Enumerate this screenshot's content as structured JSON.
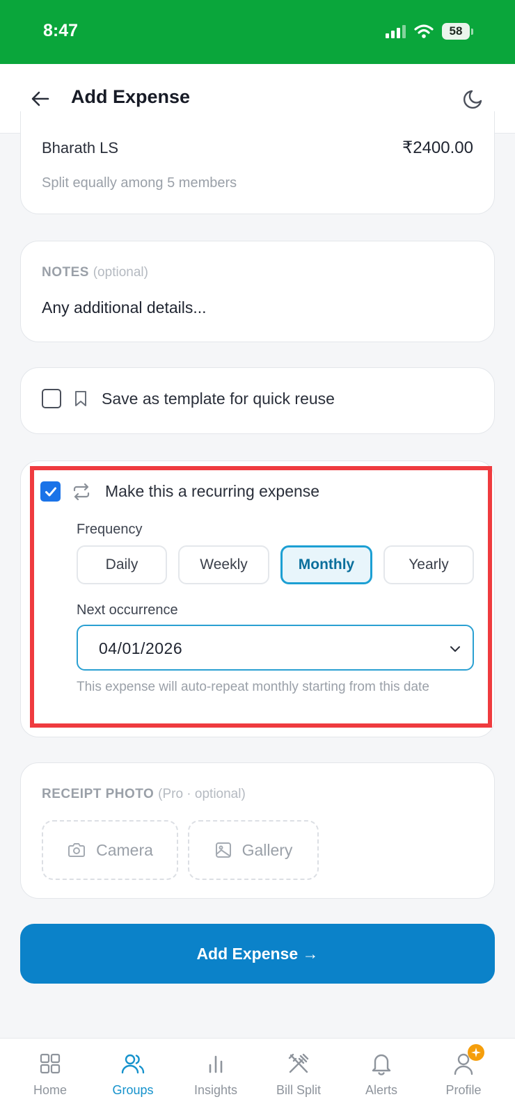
{
  "status_bar": {
    "time": "8:47",
    "battery": "58"
  },
  "header": {
    "title": "Add Expense",
    "back_icon": "arrow-left-icon",
    "theme_icon": "moon-icon"
  },
  "split": {
    "payer_name": "Bharath LS",
    "amount": "₹2400.00",
    "note": "Split equally among 5 members"
  },
  "notes": {
    "label": "NOTES",
    "optional": "(optional)",
    "placeholder": "Any additional details..."
  },
  "template": {
    "checked": false,
    "label": "Save as template for quick reuse",
    "icon": "bookmark-icon"
  },
  "recurring": {
    "checked": true,
    "label": "Make this a recurring expense",
    "icon": "repeat-icon",
    "frequency_label": "Frequency",
    "frequency_options": [
      "Daily",
      "Weekly",
      "Monthly",
      "Yearly"
    ],
    "selected_frequency": "Monthly",
    "next_label": "Next occurrence",
    "next_date": "04/01/2026",
    "auto_note": "This expense will auto-repeat monthly starting from this date"
  },
  "receipt": {
    "label": "RECEIPT PHOTO",
    "optional": "(Pro · optional)",
    "camera_label": "Camera",
    "gallery_label": "Gallery"
  },
  "submit": {
    "label": "Add Expense →"
  },
  "bottom_nav": {
    "items": [
      {
        "label": "Home",
        "icon": "grid-icon"
      },
      {
        "label": "Groups",
        "icon": "users-icon",
        "active": true
      },
      {
        "label": "Insights",
        "icon": "bar-chart-icon"
      },
      {
        "label": "Bill Split",
        "icon": "utensils-crossed-icon"
      },
      {
        "label": "Alerts",
        "icon": "bell-icon"
      },
      {
        "label": "Profile",
        "icon": "user-icon"
      }
    ]
  },
  "colors": {
    "status_bar": "#0aa63b",
    "primary": "#0b82c9",
    "selected_border": "#1c9fd3",
    "highlight": "#ef3b3f",
    "checkbox": "#1a73e8",
    "nav_active": "#1592cc"
  }
}
